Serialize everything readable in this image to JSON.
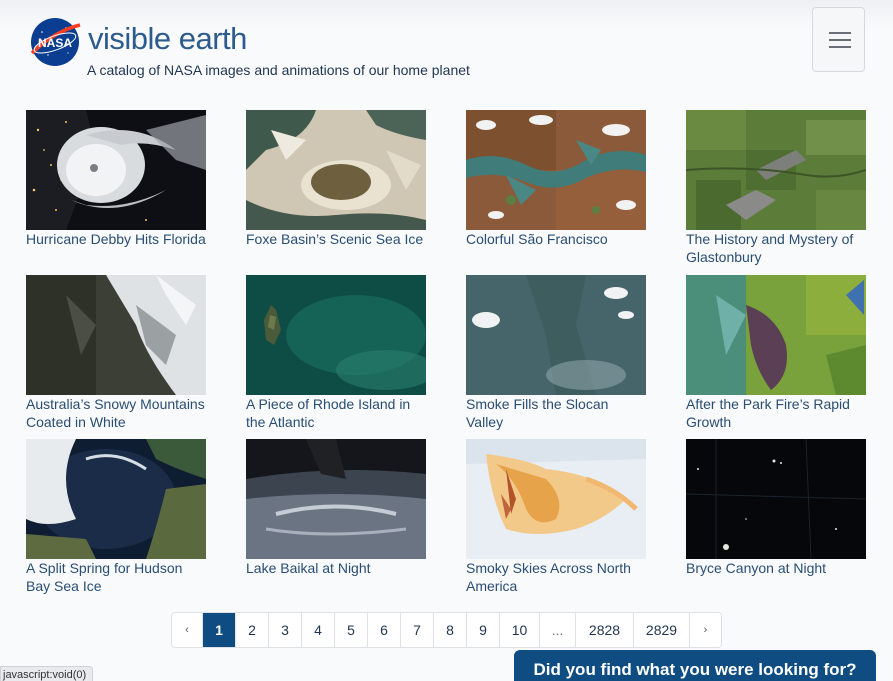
{
  "header": {
    "logo_text": "NASA",
    "brand": "visible earth",
    "tagline": "A catalog of NASA images and animations of our home planet"
  },
  "menu": {
    "icon": "hamburger-icon"
  },
  "gallery": [
    {
      "title": "Hurricane Debby Hits Florida",
      "thumb": "hurricane"
    },
    {
      "title": "Foxe Basin’s Scenic Sea Ice",
      "thumb": "seaice"
    },
    {
      "title": "Colorful São Francisco",
      "thumb": "river"
    },
    {
      "title": "The History and Mystery of Glastonbury",
      "thumb": "green"
    },
    {
      "title": "Australia’s Snowy Mountains Coated in White",
      "thumb": "snow"
    },
    {
      "title": "A Piece of Rhode Island in the Atlantic",
      "thumb": "ocean"
    },
    {
      "title": "Smoke Fills the Slocan Valley",
      "thumb": "smoke"
    },
    {
      "title": "After the Park Fire’s Rapid Growth",
      "thumb": "fire"
    },
    {
      "title": "A Split Spring for Hudson Bay Sea Ice",
      "thumb": "bay"
    },
    {
      "title": "Lake Baikal at Night",
      "thumb": "baikal"
    },
    {
      "title": "Smoky Skies Across North America",
      "thumb": "map"
    },
    {
      "title": "Bryce Canyon at Night",
      "thumb": "night"
    }
  ],
  "pagination": {
    "prev": "‹",
    "next": "›",
    "pages": [
      "1",
      "2",
      "3",
      "4",
      "5",
      "6",
      "7",
      "8",
      "9",
      "10",
      "...",
      "2828",
      "2829"
    ],
    "current": "1"
  },
  "feedback": {
    "label": "Did you find what you were looking for?"
  },
  "status_bar": {
    "url": "javascript:void(0)"
  }
}
